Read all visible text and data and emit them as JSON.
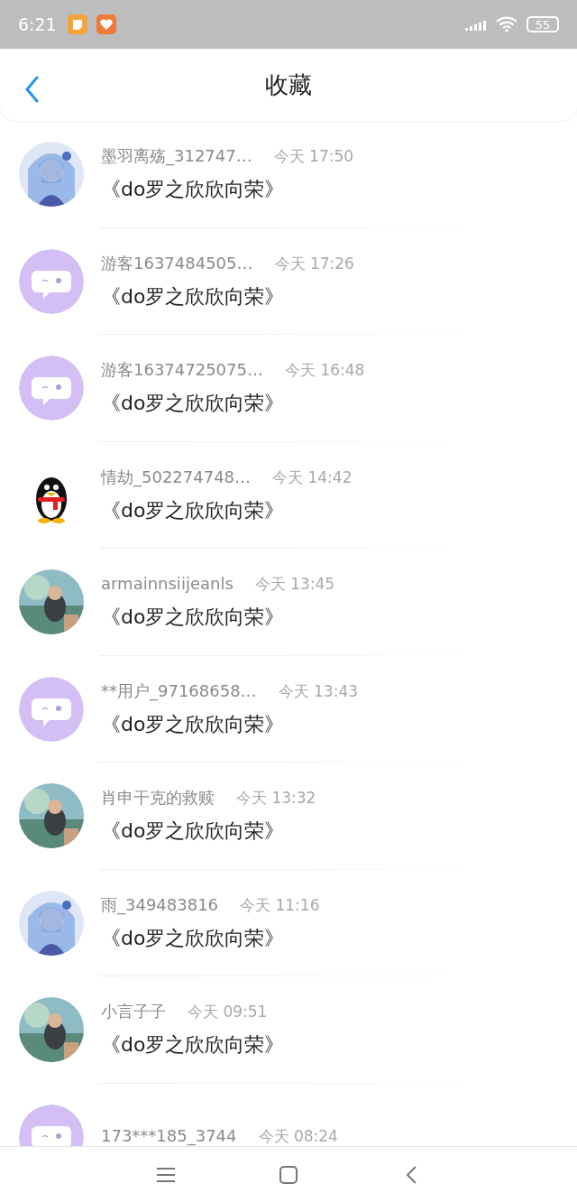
{
  "status_bar": {
    "time": "6:21",
    "battery": "55"
  },
  "header": {
    "title": "收藏"
  },
  "items": [
    {
      "avatar": {
        "kind": "anime"
      },
      "name": "墨羽离殇_312747…",
      "time": "今天 17:50",
      "title": "《do罗之欣欣向荣》"
    },
    {
      "avatar": {
        "kind": "default"
      },
      "name": "游客1637484505…",
      "time": "今天 17:26",
      "title": "《do罗之欣欣向荣》"
    },
    {
      "avatar": {
        "kind": "default"
      },
      "name": "游客16374725075…",
      "time": "今天 16:48",
      "title": "《do罗之欣欣向荣》"
    },
    {
      "avatar": {
        "kind": "penguin"
      },
      "name": "情劫_502274748…",
      "time": "今天 14:42",
      "title": "《do罗之欣欣向荣》"
    },
    {
      "name": "armainnsiijeanls",
      "time": "今天 13:45",
      "title": "《do罗之欣欣向荣》"
    },
    {
      "avatar": {
        "kind": "default"
      },
      "name": "**用户_97168658…",
      "time": "今天 13:43",
      "title": "《do罗之欣欣向荣》"
    },
    {
      "name": "肖申干克的救赎",
      "time": "今天 13:32",
      "title": "《do罗之欣欣向荣》"
    },
    {
      "avatar": {
        "kind": "anime"
      },
      "name": "雨_349483816",
      "time": "今天 11:16",
      "title": "《do罗之欣欣向荣》"
    },
    {
      "name": "小言子子",
      "time": "今天 09:51",
      "title": "《do罗之欣欣向荣》"
    },
    {
      "avatar": {
        "kind": "default"
      },
      "name": "173***185_3744",
      "time": "今天 08:24"
    }
  ]
}
